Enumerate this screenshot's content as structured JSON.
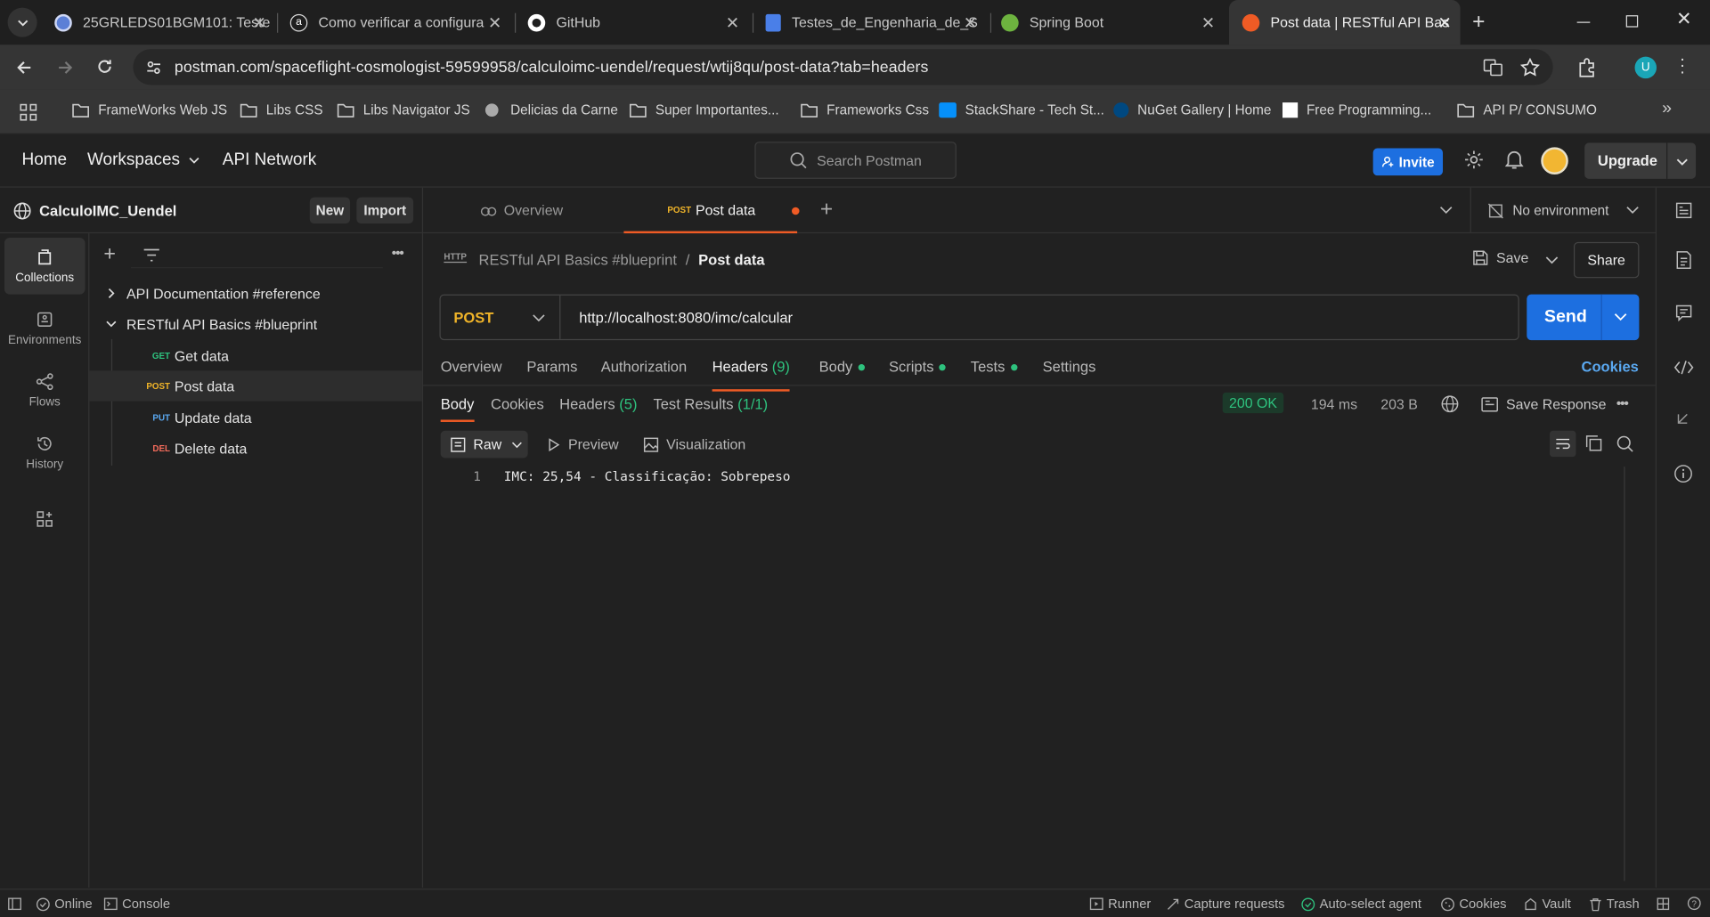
{
  "browser": {
    "tabs": [
      {
        "title": "25GRLEDS01BGM101: Teste",
        "color": "#5b7fd6"
      },
      {
        "title": "Como verificar a configura",
        "color": "#ffffff"
      },
      {
        "title": "GitHub",
        "color": "#ffffff"
      },
      {
        "title": "Testes_de_Engenharia_de_S",
        "color": "#4a7fe8"
      },
      {
        "title": "Spring Boot",
        "color": "#6db33f"
      },
      {
        "title": "Post data | RESTful API Bas",
        "color": "#ef5b25"
      }
    ],
    "url": "postman.com/spaceflight-cosmologist-59599958/calculoimc-uendel/request/wtij8qu/post-data?tab=headers",
    "profile_initial": "U",
    "bookmarks": [
      "FrameWorks Web JS",
      "Libs CSS",
      "Libs Navigator JS",
      "Delicias da Carne",
      "Super Importantes...",
      "Frameworks Css",
      "StackShare - Tech St...",
      "NuGet Gallery | Home",
      "Free Programming...",
      "API P/ CONSUMO"
    ]
  },
  "header": {
    "home": "Home",
    "workspaces": "Workspaces",
    "api_network": "API Network",
    "search_placeholder": "Search Postman",
    "invite": "Invite",
    "upgrade": "Upgrade"
  },
  "workspace": {
    "name": "CalculoIMC_Uendel",
    "new_label": "New",
    "import_label": "Import"
  },
  "rail": {
    "collections": "Collections",
    "environments": "Environments",
    "flows": "Flows",
    "history": "History"
  },
  "tree": {
    "folders": [
      {
        "name": "API Documentation #reference"
      },
      {
        "name": "RESTful API Basics #blueprint"
      }
    ],
    "requests": [
      {
        "method": "GET",
        "name": "Get data",
        "color": "#2ec27e"
      },
      {
        "method": "POST",
        "name": "Post data",
        "color": "#f0b429"
      },
      {
        "method": "PUT",
        "name": "Update data",
        "color": "#5aa8f0"
      },
      {
        "method": "DEL",
        "name": "Delete data",
        "color": "#f26b5b"
      }
    ]
  },
  "request_tabs": {
    "overview": "Overview",
    "active_method": "POST",
    "active_name": "Post data",
    "environment": "No environment"
  },
  "request": {
    "breadcrumb_parent": "RESTful API Basics #blueprint",
    "breadcrumb_sep": "/",
    "title": "Post data",
    "save": "Save",
    "share": "Share",
    "method": "POST",
    "url": "http://localhost:8080/imc/calcular",
    "send": "Send",
    "tabs": {
      "overview": "Overview",
      "params": "Params",
      "authorization": "Authorization",
      "headers": "Headers",
      "headers_count": "(9)",
      "body": "Body",
      "scripts": "Scripts",
      "tests": "Tests",
      "settings": "Settings",
      "cookies": "Cookies"
    }
  },
  "response": {
    "tabs": {
      "body": "Body",
      "cookies": "Cookies",
      "headers": "Headers",
      "headers_count": "(5)",
      "test_results": "Test Results",
      "test_count": "(1/1)"
    },
    "status": "200 OK",
    "time": "194 ms",
    "size": "203 B",
    "save_response": "Save Response",
    "format": "Raw",
    "preview": "Preview",
    "visualization": "Visualization",
    "lines": [
      {
        "num": "1",
        "text": "IMC: 25,54 - Classificação: Sobrepeso"
      }
    ]
  },
  "statusbar": {
    "online": "Online",
    "console": "Console",
    "runner": "Runner",
    "capture": "Capture requests",
    "agent": "Auto-select agent",
    "cookies": "Cookies",
    "vault": "Vault",
    "trash": "Trash"
  }
}
